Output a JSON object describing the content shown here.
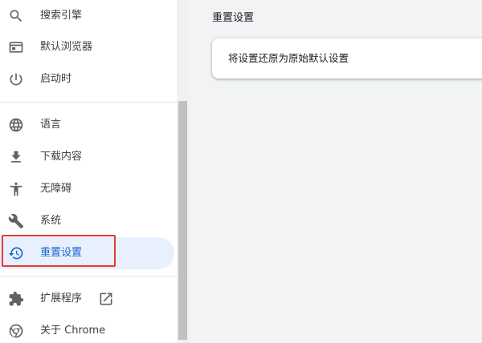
{
  "sidebar": {
    "items": [
      {
        "label": "搜索引擎",
        "icon": "search-icon"
      },
      {
        "label": "默认浏览器",
        "icon": "browser-window-icon"
      },
      {
        "label": "启动时",
        "icon": "power-icon"
      },
      {
        "label": "语言",
        "icon": "globe-icon"
      },
      {
        "label": "下载内容",
        "icon": "download-icon"
      },
      {
        "label": "无障碍",
        "icon": "accessibility-icon"
      },
      {
        "label": "系统",
        "icon": "wrench-icon"
      },
      {
        "label": "重置设置",
        "icon": "restore-icon",
        "active": true
      },
      {
        "label": "扩展程序",
        "icon": "puzzle-icon"
      },
      {
        "label": "关于 Chrome",
        "icon": "chrome-icon"
      }
    ]
  },
  "main": {
    "section_title": "重置设置",
    "card": {
      "row_label": "将设置还原为原始默认设置"
    }
  },
  "colors": {
    "active_bg": "#e8f0fe",
    "active_text": "#1967d2",
    "highlight": "#e53935"
  }
}
